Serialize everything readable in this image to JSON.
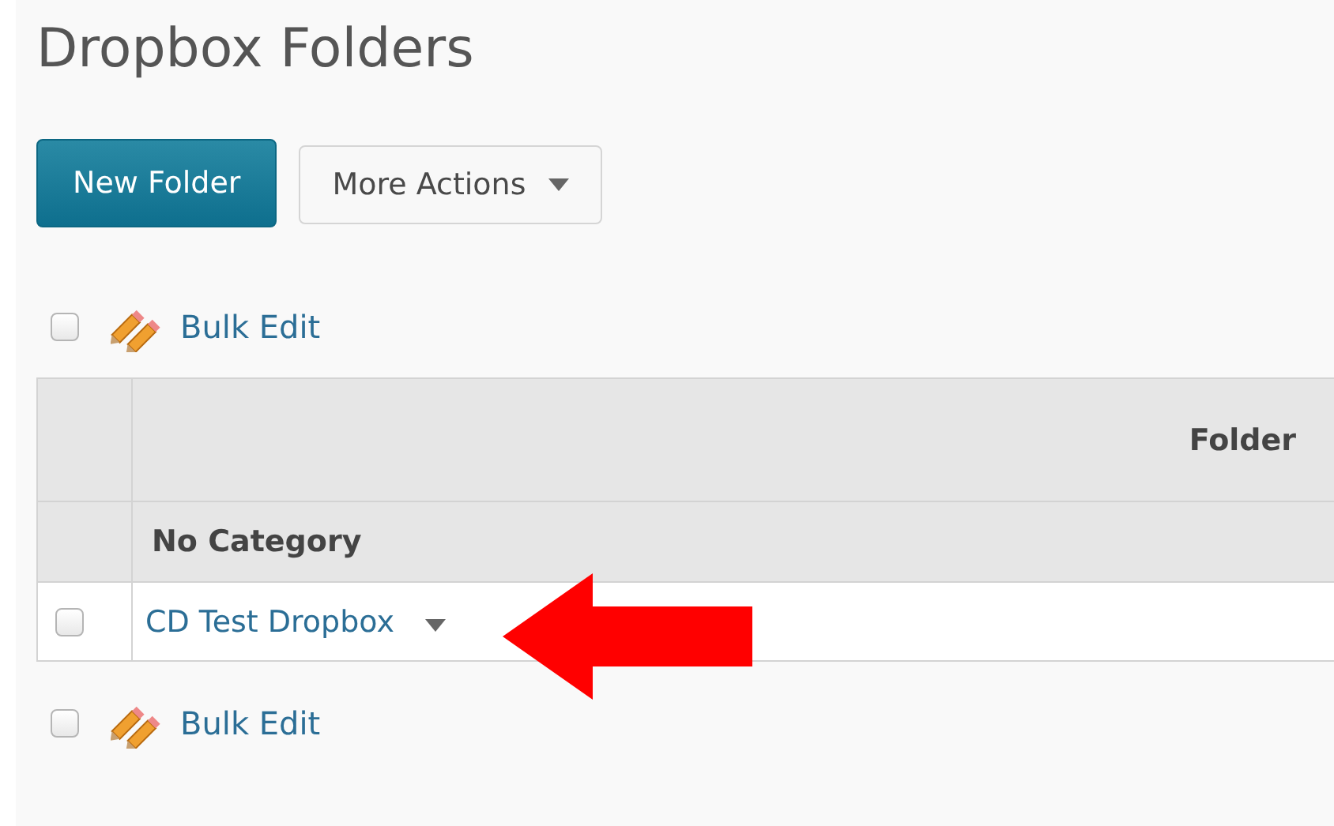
{
  "page_title": "Dropbox Folders",
  "toolbar": {
    "primary_button": "New Folder",
    "menu_button": "More Actions"
  },
  "bulk_edit_top": {
    "checked": false,
    "label": "Bulk Edit"
  },
  "table": {
    "columns": [
      "Folder"
    ],
    "groups": [
      {
        "name": "No Category",
        "rows": [
          {
            "checked": false,
            "name": "CD Test Dropbox"
          }
        ]
      }
    ]
  },
  "bulk_edit_bottom": {
    "checked": false,
    "label": "Bulk Edit"
  }
}
